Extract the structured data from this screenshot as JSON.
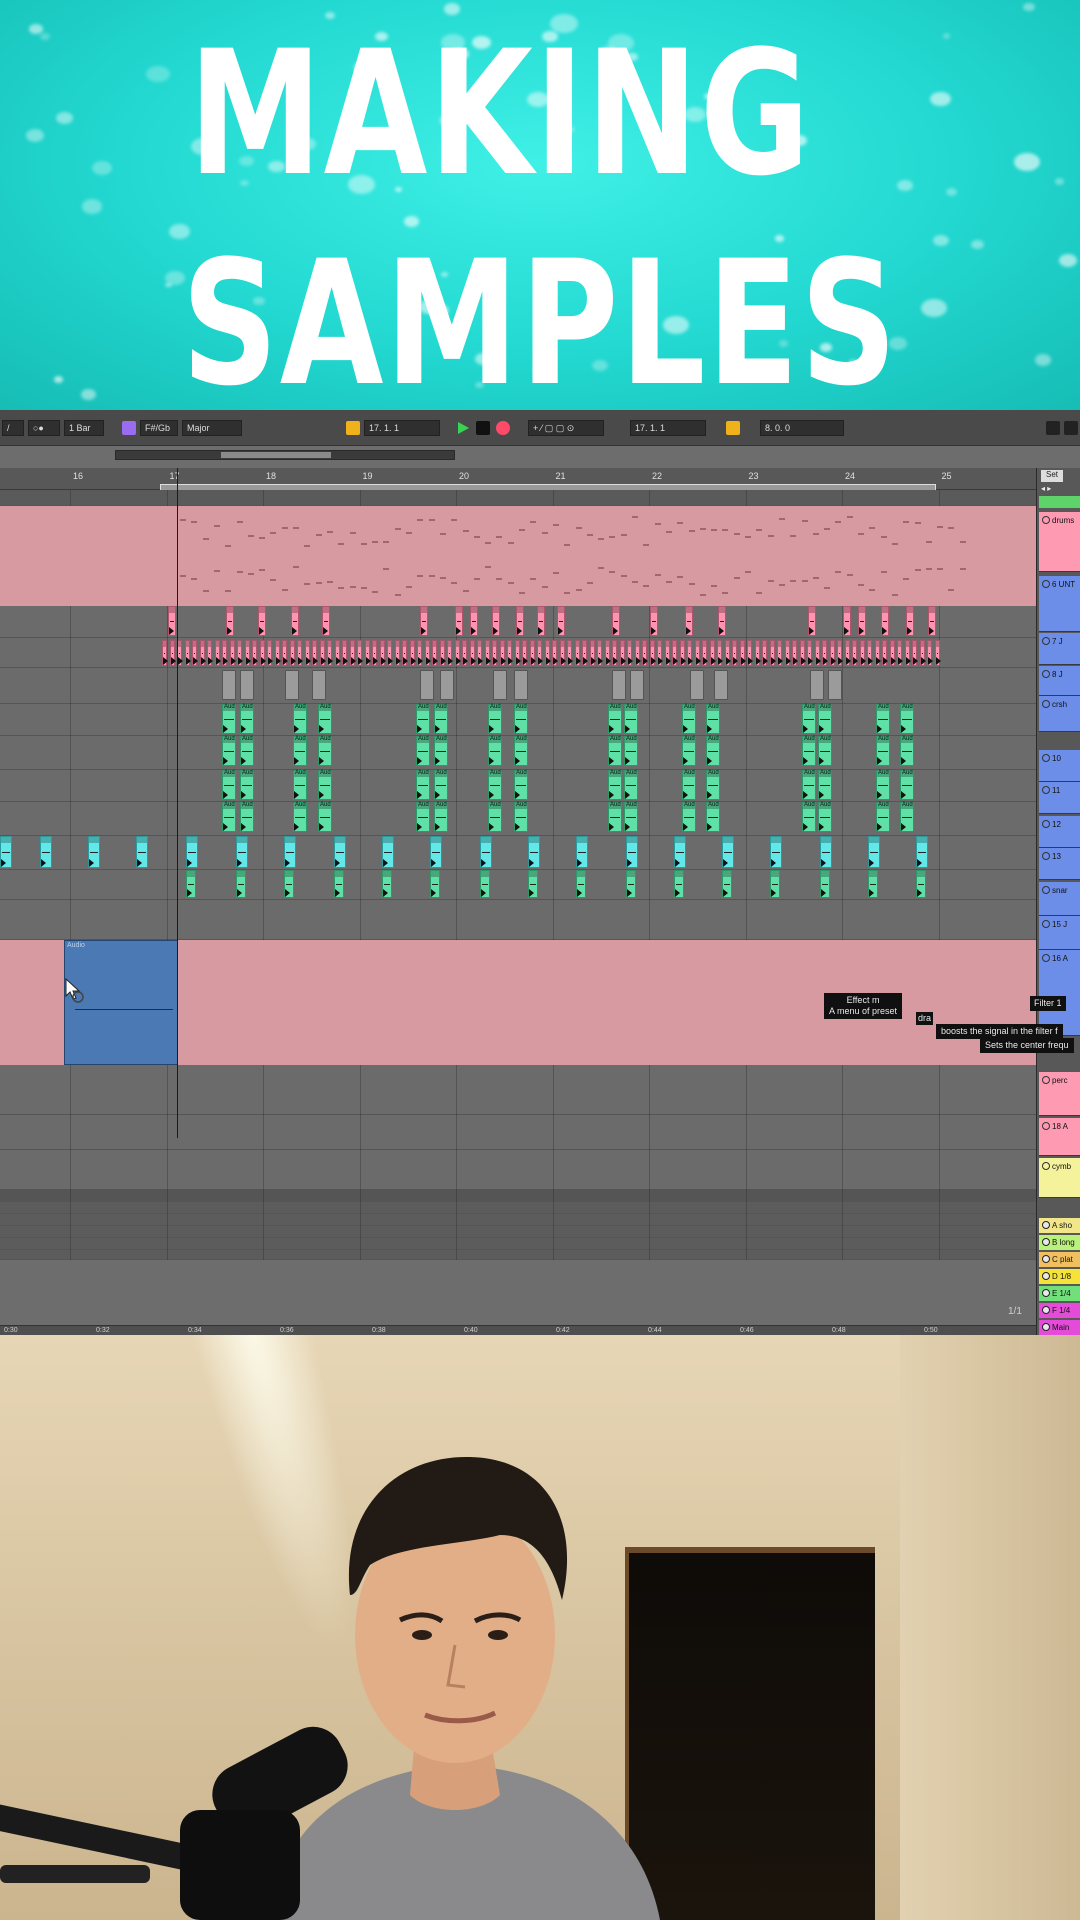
{
  "banner": {
    "title_line1": "MAKING",
    "title_line2": "SAMPLES"
  },
  "transport": {
    "quantize": "1 Bar",
    "key": "F#/Gb",
    "scale": "Major",
    "position": "17.   1.   1",
    "loop_start": "17.   1.   1",
    "loop_length": "8.   0.   0",
    "set_label": "Set"
  },
  "ruler": {
    "bars": [
      "16",
      "17",
      "18",
      "19",
      "20",
      "21",
      "22",
      "23",
      "24",
      "25"
    ]
  },
  "time_ruler": {
    "labels": [
      "0:30",
      "0:32",
      "0:34",
      "0:36",
      "0:38",
      "0:40",
      "0:42",
      "0:44",
      "0:46",
      "0:48",
      "0:50"
    ]
  },
  "clips": {
    "audio_label": "Aud",
    "blue_clip_label": "Audio"
  },
  "tooltips": {
    "effect_title": "Effect m",
    "effect_desc": "A menu of preset",
    "effect_extra": "dra",
    "filter_title": "Filter 1",
    "filter_desc": "boosts the signal in the filter f",
    "filter_desc2": "Sets the center frequ"
  },
  "tracks": [
    {
      "name": "drums",
      "color": "#ff9ab3"
    },
    {
      "name": "6 UNT",
      "color": "#6c8ee8"
    },
    {
      "name": "7 J",
      "color": "#6c8ee8"
    },
    {
      "name": "8 J",
      "color": "#6c8ee8"
    },
    {
      "name": "crsh",
      "color": "#6c8ee8"
    },
    {
      "name": "10",
      "color": "#6c8ee8"
    },
    {
      "name": "11",
      "color": "#6c8ee8"
    },
    {
      "name": "12",
      "color": "#6c8ee8"
    },
    {
      "name": "13",
      "color": "#6c8ee8"
    },
    {
      "name": "snar",
      "color": "#6c8ee8"
    },
    {
      "name": "15 J",
      "color": "#6c8ee8"
    },
    {
      "name": "16 A",
      "color": "#6c8ee8"
    },
    {
      "name": "perc",
      "color": "#ff9ab3"
    },
    {
      "name": "18 A",
      "color": "#ff9ab3"
    },
    {
      "name": "cymb",
      "color": "#f4f29a"
    }
  ],
  "returns": [
    {
      "name": "A sho",
      "color": "#f2e68a"
    },
    {
      "name": "B long",
      "color": "#b9f27a"
    },
    {
      "name": "C plat",
      "color": "#f0c060"
    },
    {
      "name": "D 1/8",
      "color": "#f5e33a"
    },
    {
      "name": "E 1/4",
      "color": "#72e07a"
    },
    {
      "name": "F 1/4",
      "color": "#e34bd8"
    },
    {
      "name": "Main",
      "color": "#e34bd8"
    }
  ],
  "page_indicator": "1/1"
}
